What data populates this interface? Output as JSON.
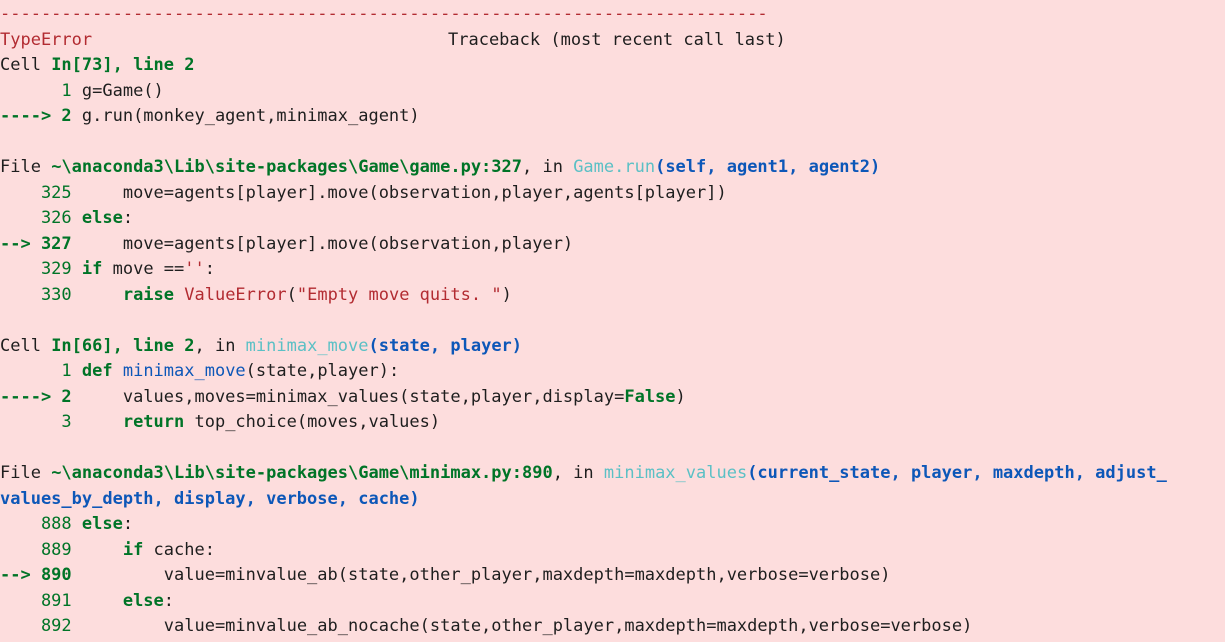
{
  "traceback": {
    "separator": "---------------------------------------------------------------------------",
    "error_type": "TypeError",
    "header": "Traceback (most recent call last)",
    "frames": [
      {
        "location_prefix": "Cell ",
        "location": "In[73], line 2",
        "lines": [
          {
            "marker": "      1",
            "code": " g=Game()"
          },
          {
            "marker": "----> 2",
            "code": " g.run(monkey_agent,minimax_agent)"
          }
        ]
      },
      {
        "location_prefix": "File ",
        "location": "~\\anaconda3\\Lib\\site-packages\\Game\\game.py:327",
        "in_text": ", in ",
        "func_name": "Game.run",
        "func_args": "(self, agent1, agent2)",
        "lines": [
          {
            "marker": "    325",
            "code": "     move=agents[player].move(observation,player,agents[player])"
          },
          {
            "marker": "    326",
            "keyword": " else",
            "code": ":"
          },
          {
            "marker": "--> 327",
            "code": "     move=agents[player].move(observation,player)"
          },
          {
            "marker": "    329",
            "keyword": " if",
            "code": " move ==",
            "string": "''",
            "code_after": ":"
          },
          {
            "marker": "    330",
            "keyword": "     raise",
            "exception": " ValueError",
            "code": "(",
            "string": "\"Empty move quits. \"",
            "code_after": ")"
          }
        ]
      },
      {
        "location_prefix": "Cell ",
        "location": "In[66], line 2",
        "in_text": ", in ",
        "func_name": "minimax_move",
        "func_args": "(state, player)",
        "lines": [
          {
            "marker": "      1",
            "keyword": " def",
            "defname": " minimax_move",
            "code": "(state,player):"
          },
          {
            "marker": "----> 2",
            "code": "     values,moves=minimax_values(state,player,display=",
            "bool": "False",
            "code_after": ")"
          },
          {
            "marker": "      3",
            "keyword": "     return",
            "code": " top_choice(moves,values)"
          }
        ]
      },
      {
        "location_prefix": "File ",
        "location": "~\\anaconda3\\Lib\\site-packages\\Game\\minimax.py:890",
        "in_text": ", in ",
        "func_name": "minimax_values",
        "func_args": "(current_state, player, maxdepth, adjust_",
        "func_args_cont": "values_by_depth, display, verbose, cache)",
        "lines": [
          {
            "marker": "    888",
            "keyword": " else",
            "code": ":"
          },
          {
            "marker": "    889",
            "keyword": "     if",
            "code": " cache:"
          },
          {
            "marker": "--> 890",
            "code": "         value=minvalue_ab(state,other_player,maxdepth=maxdepth,verbose=verbose)"
          },
          {
            "marker": "    891",
            "keyword": "     else",
            "code": ":"
          },
          {
            "marker": "    892",
            "code": "         value=minvalue_ab_nocache(state,other_player,maxdepth=maxdepth,verbose=verbose)"
          }
        ]
      }
    ]
  }
}
